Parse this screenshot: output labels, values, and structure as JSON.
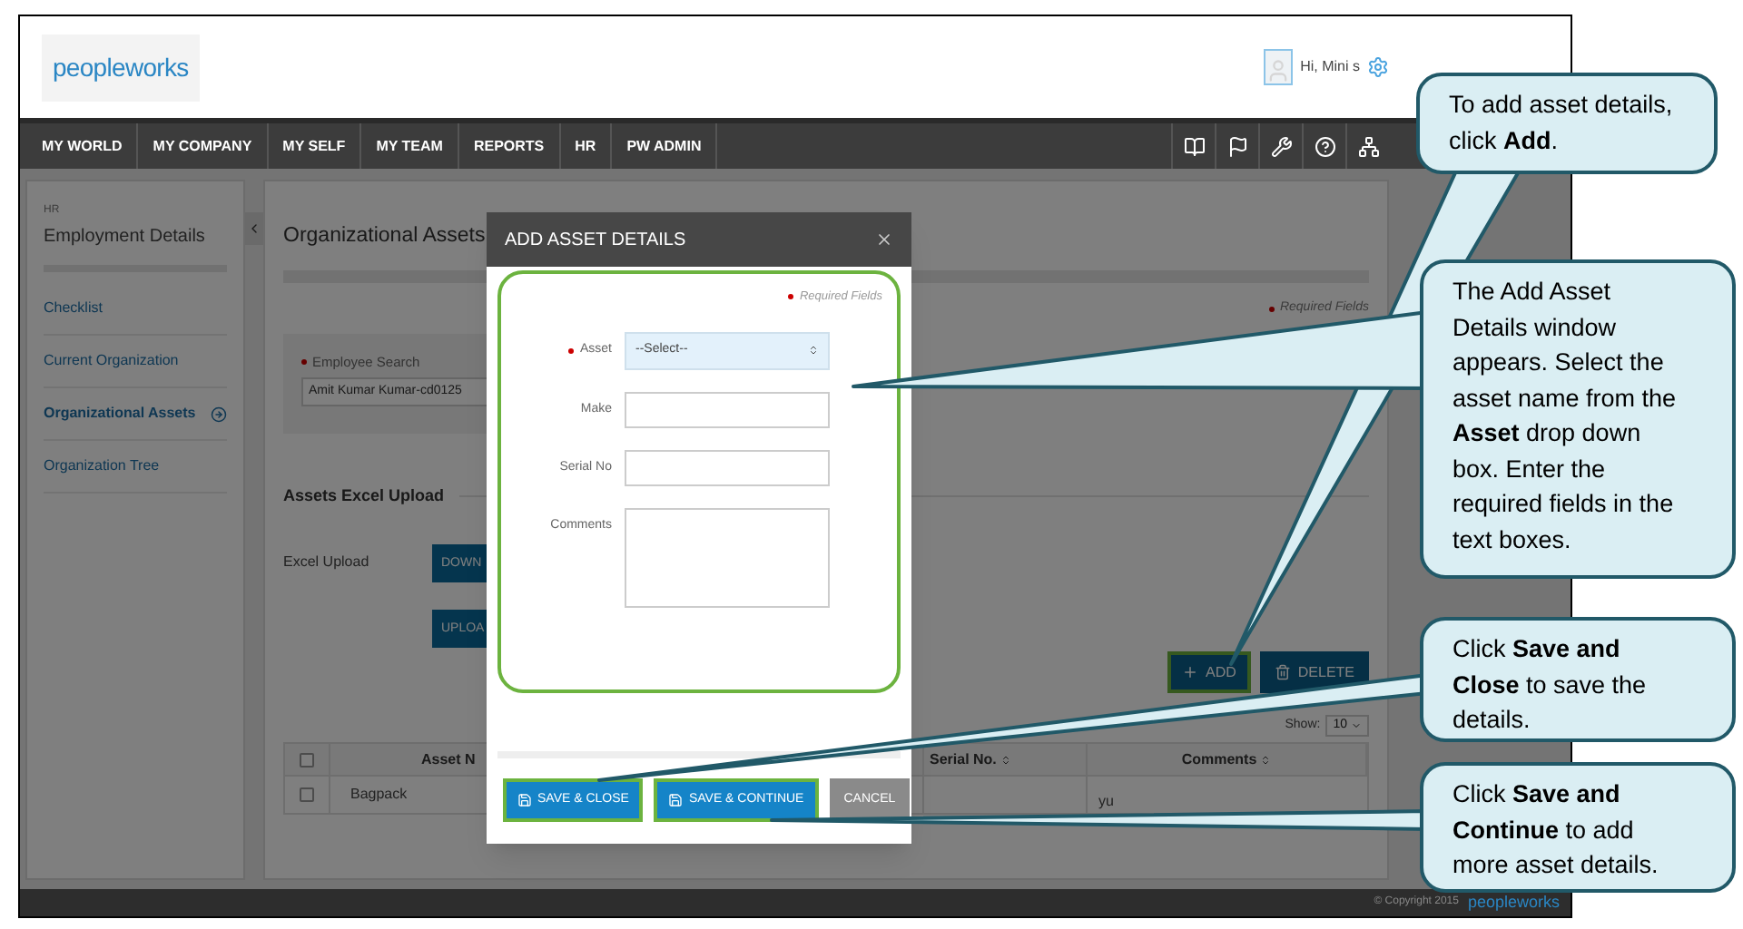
{
  "header": {
    "logo": "peopleworks",
    "greeting": "Hi, Mini s"
  },
  "nav": [
    {
      "label": "MY WORLD"
    },
    {
      "label": "MY COMPANY"
    },
    {
      "label": "MY SELF"
    },
    {
      "label": "MY TEAM"
    },
    {
      "label": "REPORTS"
    },
    {
      "label": "HR"
    },
    {
      "label": "PW ADMIN"
    }
  ],
  "sidebar": {
    "section": "HR",
    "title": "Employment Details",
    "items": [
      {
        "label": "Checklist",
        "selected": false
      },
      {
        "label": "Current Organization",
        "selected": false
      },
      {
        "label": "Organizational Assets",
        "selected": true
      },
      {
        "label": "Organization Tree",
        "selected": false
      }
    ]
  },
  "page": {
    "title": "Organizational Assets",
    "required_note": "Required Fields",
    "employee_search": {
      "label": "Employee Search",
      "required": true,
      "value": "Amit Kumar Kumar-cd0125"
    },
    "upload": {
      "title": "Assets Excel Upload",
      "label": "Excel Upload",
      "buttons": [
        "DOWN",
        "UPLOA"
      ]
    },
    "actions": [
      {
        "label": "ADD",
        "kind": "add",
        "highlighted": true
      },
      {
        "label": "DELETE",
        "kind": "delete",
        "highlighted": false
      }
    ],
    "show": {
      "label": "Show:",
      "value": "10"
    },
    "table": {
      "select_all_checked": false,
      "columns": [
        {
          "label": "Asset N",
          "kind": "asset",
          "sortable": false
        },
        {
          "label": "Serial No.",
          "kind": "serial",
          "sortable": true
        },
        {
          "label": "Comments",
          "kind": "comments",
          "sortable": true
        }
      ],
      "rows": [
        {
          "checked": false,
          "asset": "Bagpack",
          "comments": "yu"
        }
      ]
    }
  },
  "dialog": {
    "title": "ADD ASSET DETAILS",
    "required_note": "Required Fields",
    "form_highlighted": true,
    "fields": [
      {
        "label": "Asset",
        "kind": "select",
        "required": true,
        "value": "--Select--"
      },
      {
        "label": "Make",
        "kind": "text",
        "required": false
      },
      {
        "label": "Serial No",
        "kind": "text",
        "required": false
      },
      {
        "label": "Comments",
        "kind": "textarea",
        "required": false
      }
    ],
    "buttons": [
      {
        "label": "SAVE & CLOSE",
        "kind": "save",
        "highlighted": true
      },
      {
        "label": "SAVE & CONTINUE",
        "kind": "save",
        "highlighted": true
      },
      {
        "label": "CANCEL",
        "kind": "cancel",
        "highlighted": false
      }
    ]
  },
  "footer": {
    "copyright": "© Copyright 2015",
    "logo": "peopleworks"
  },
  "callouts": [
    {
      "text": "To add asset details, click **Add**."
    },
    {
      "text": "The Add Asset Details window appears. Select the asset name from the **Asset** drop down box. Enter the required fields in the text boxes."
    },
    {
      "text": "Click **Save and Close** to save the details."
    },
    {
      "text": "Click **Save and Continue** to add more asset details."
    }
  ]
}
